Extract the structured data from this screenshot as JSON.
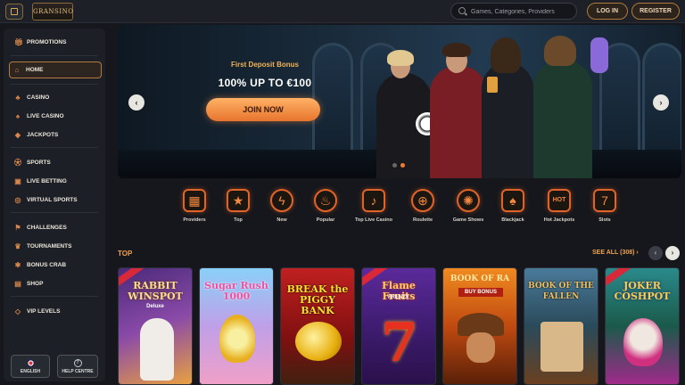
{
  "header": {
    "logo_text": "GRANSINO",
    "search_placeholder": "Games, Categories, Providers",
    "login_label": "LOG IN",
    "register_label": "REGISTER"
  },
  "sidebar": {
    "items": [
      {
        "label": "PROMOTIONS",
        "icon": "gift-icon"
      },
      {
        "label": "HOME",
        "icon": "home-icon",
        "active": true
      },
      {
        "label": "CASINO",
        "icon": "casino-icon"
      },
      {
        "label": "LIVE CASINO",
        "icon": "live-casino-icon"
      },
      {
        "label": "JACKPOTS",
        "icon": "jackpot-icon"
      },
      {
        "label": "SPORTS",
        "icon": "sports-icon"
      },
      {
        "label": "LIVE BETTING",
        "icon": "live-betting-icon"
      },
      {
        "label": "VIRTUAL SPORTS",
        "icon": "virtual-sports-icon"
      },
      {
        "label": "CHALLENGES",
        "icon": "challenges-icon"
      },
      {
        "label": "TOURNAMENTS",
        "icon": "tournaments-icon"
      },
      {
        "label": "BONUS CRAB",
        "icon": "bonus-crab-icon"
      },
      {
        "label": "SHOP",
        "icon": "shop-icon"
      },
      {
        "label": "VIP LEVELS",
        "icon": "vip-icon"
      }
    ],
    "language_label": "ENGLISH",
    "help_label": "HELP CENTRE"
  },
  "banner": {
    "title": "First Deposit Bonus",
    "amount": "100% UP TO €100",
    "cta_label": "JOIN NOW",
    "slide_count": 2,
    "active_slide": 2
  },
  "categories": [
    {
      "label": "Providers",
      "icon": "providers-icon"
    },
    {
      "label": "Top",
      "icon": "star-icon"
    },
    {
      "label": "New",
      "icon": "lightning-icon"
    },
    {
      "label": "Popular",
      "icon": "flame-icon"
    },
    {
      "label": "Top Live Casino",
      "icon": "microphone-icon"
    },
    {
      "label": "Roulette",
      "icon": "roulette-icon"
    },
    {
      "label": "Game Shows",
      "icon": "wheel-icon"
    },
    {
      "label": "Blackjack",
      "icon": "cards-icon"
    },
    {
      "label": "Hot Jackpots",
      "icon": "hot-icon"
    },
    {
      "label": "Slots",
      "icon": "slot-machine-icon"
    }
  ],
  "top_games": {
    "title": "TOP",
    "see_all_label": "SEE ALL (308)",
    "games": [
      {
        "title": "RABBIT WINSPOT",
        "subtitle": "Deluxe",
        "colors": [
          "#5a3a8a",
          "#e8a040"
        ]
      },
      {
        "title": "Sugar Rush 1000",
        "subtitle": "",
        "colors": [
          "#7ac4f0",
          "#f090c8"
        ]
      },
      {
        "title": "BREAK the PIGGY BANK",
        "subtitle": "",
        "colors": [
          "#a01818",
          "#e8c020"
        ]
      },
      {
        "title": "Flame Fruits",
        "subtitle": "FRENZY",
        "colors": [
          "#3a1a6a",
          "#e83020"
        ]
      },
      {
        "title": "BOOK OF RA",
        "subtitle": "BUY BONUS",
        "colors": [
          "#f07820",
          "#6a2a10"
        ]
      },
      {
        "title": "BOOK OF THE FALLEN",
        "subtitle": "",
        "colors": [
          "#3a6a8a",
          "#c08050"
        ]
      },
      {
        "title": "JOKER COSHPOT",
        "subtitle": "",
        "colors": [
          "#1a6a4a",
          "#d040a0"
        ]
      }
    ]
  }
}
